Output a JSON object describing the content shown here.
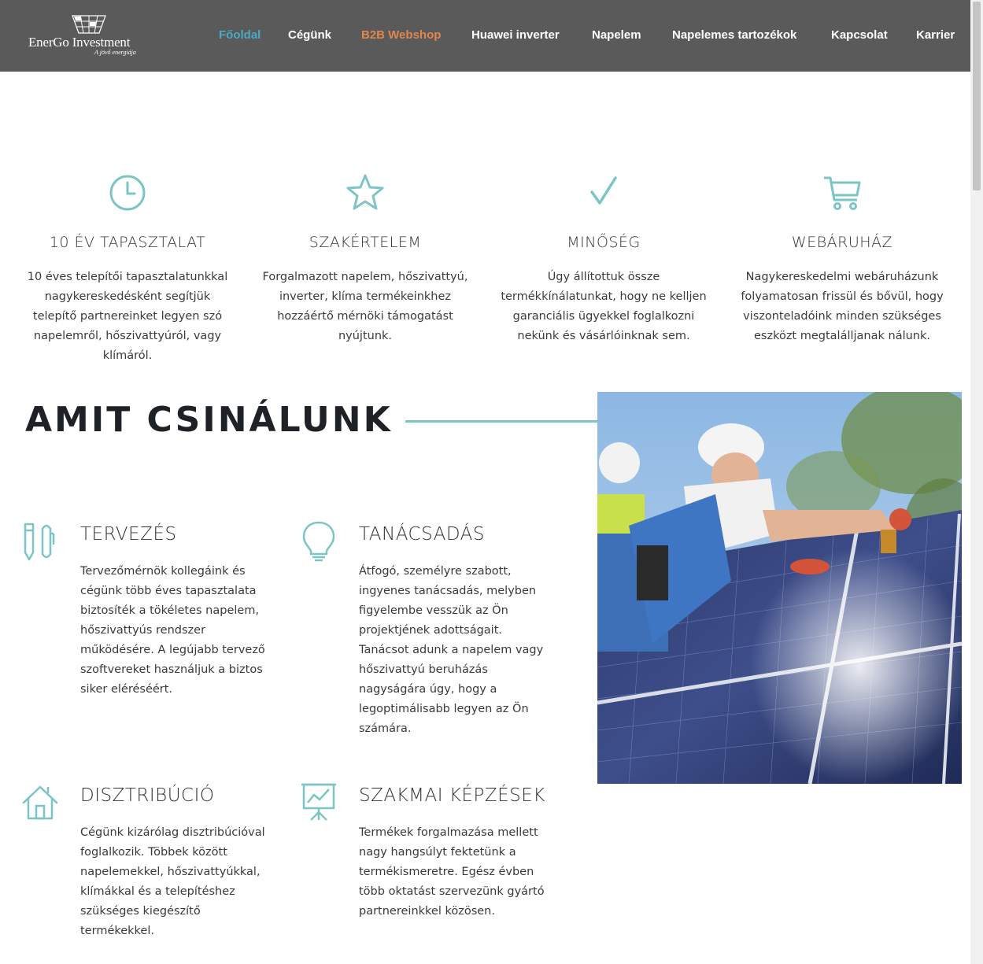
{
  "header": {
    "logo_name": "EnerGo Investment",
    "logo_tagline": "A jövő energiája",
    "nav": [
      {
        "label": "Főoldal"
      },
      {
        "label": "Cégünk"
      },
      {
        "label": "B2B Webshop"
      },
      {
        "label": "Huawei inverter"
      },
      {
        "label": "Napelem"
      },
      {
        "label": "Napelemes tartozékok"
      },
      {
        "label": "Kapcsolat"
      },
      {
        "label": "Karrier"
      }
    ]
  },
  "features": [
    {
      "icon": "clock-icon",
      "title": "10 ÉV TAPASZTALAT",
      "text": "10 éves telepítői tapasztalatunkkal nagykereskedésként segítjük telepítő partnereinket legyen szó napelemről, hőszivattyúról, vagy klímáról."
    },
    {
      "icon": "star-icon",
      "title": "SZAKÉRTELEM",
      "text": "Forgalmazott napelem, hőszivattyú, inverter, klíma termékeinkhez hozzáértő mérnöki támogatást nyújtunk."
    },
    {
      "icon": "checkmark-icon",
      "title": "MINŐSÉG",
      "text": "Úgy állítottuk össze termékkínálatunkat, hogy ne kelljen garanciális ügyekkel foglalkozni nekünk és vásárlóinknak sem."
    },
    {
      "icon": "shopping-cart-icon",
      "title": "WEBÁRUHÁZ",
      "text": "Nagykereskedelmi webáruházunk folyamatosan frissül és bővül, hogy viszonteladóink minden szükséges eszközt megtalálljanak nálunk."
    }
  ],
  "section": {
    "title": "AMIT CSINÁLUNK"
  },
  "services": [
    {
      "icon": "pencil-pen-icon",
      "title": "TERVEZÉS",
      "text": "Tervezőmérnök kollegáink és cégünk több éves tapasztalata biztosíték a tökéletes napelem, hőszivattyús rendszer működésére. A legújabb tervező szoftvereket használjuk a biztos siker eléréséért."
    },
    {
      "icon": "lightbulb-icon",
      "title": "TANÁCSADÁS",
      "text": "Átfogó, személyre szabott, ingyenes tanácsadás, melyben figyelembe vesszük az Ön projektjének adottságait. Tanácsot adunk a napelem vagy hőszivattyú beruházás nagyságára úgy, hogy a legoptimálisabb legyen az Ön számára."
    },
    {
      "icon": "house-icon",
      "title": "DISZTRIBÚCIÓ",
      "text": "Cégünk kizárólag disztribúcióval foglalkozik. Többek között napelemekkel, hőszivattyúkkal, klímákkal és a telepítéshez szükséges kiegészítő termékekkel."
    },
    {
      "icon": "presentation-board-icon",
      "title": "SZAKMAI KÉPZÉSEK",
      "text": "Termékek forgalmazása mellett nagy hangsúlyt fektetünk a termékismeretre. Egész évben több oktatást szervezünk gyártó partnereinkkel közösen."
    }
  ],
  "colors": {
    "header_bg": "#5a5a5a",
    "accent_teal": "#7cc5c4",
    "nav_active": "#4aa9c4",
    "nav_webshop": "#e0864f",
    "heading_dark": "#1e2227"
  }
}
